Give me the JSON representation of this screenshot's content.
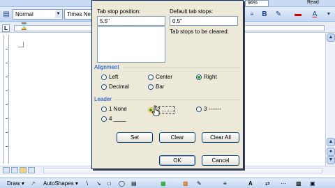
{
  "toolbar": {
    "style_value": "Normal",
    "font_value": "Times Ne",
    "zoom_value": "96%",
    "read_label": "Read",
    "bold_label": "B",
    "font_color_label": "A"
  },
  "dialog": {
    "tab_stop_position_label": "Tab stop position:",
    "tab_stop_position_value": "5.5\"",
    "default_tab_stops_label": "Default tab stops:",
    "default_tab_stops_value": "0.5\"",
    "tab_stops_cleared_label": "Tab stops to be cleared:",
    "alignment": {
      "title": "Alignment",
      "left": "Left",
      "center": "Center",
      "right": "Right",
      "decimal": "Decimal",
      "bar": "Bar",
      "selected": "right"
    },
    "leader": {
      "title": "Leader",
      "none": "1 None",
      "dots": "2 ........",
      "dashes": "3 -------",
      "line": "4 ____",
      "selected": "dots"
    },
    "buttons": {
      "set": "Set",
      "clear": "Clear",
      "clear_all": "Clear All",
      "ok": "OK",
      "cancel": "Cancel"
    }
  },
  "drawbar": {
    "draw_label": "Draw ▾",
    "autoshapes_label": "AutoShapes ▾"
  }
}
